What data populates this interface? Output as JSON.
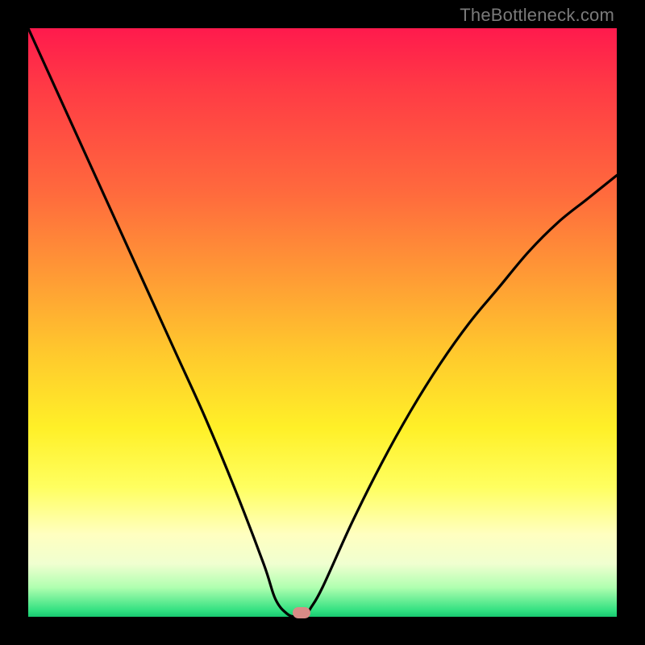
{
  "watermark": "TheBottleneck.com",
  "chart_data": {
    "type": "line",
    "title": "",
    "xlabel": "",
    "ylabel": "",
    "xlim": [
      0,
      100
    ],
    "ylim": [
      0,
      100
    ],
    "series": [
      {
        "name": "bottleneck-curve",
        "x": [
          0,
          5,
          10,
          15,
          20,
          25,
          30,
          35,
          40,
          42,
          44,
          45.5,
          47,
          48,
          50,
          55,
          60,
          65,
          70,
          75,
          80,
          85,
          90,
          95,
          100
        ],
        "values": [
          100,
          89,
          78,
          67,
          56,
          45,
          34,
          22,
          9,
          3,
          0.5,
          0,
          0,
          1.5,
          5,
          16,
          26,
          35,
          43,
          50,
          56,
          62,
          67,
          71,
          75
        ]
      }
    ],
    "annotations": [
      {
        "name": "optimal-marker",
        "x": 46.5,
        "y": 0.7
      }
    ],
    "background_gradient": {
      "top": "#ff1a4d",
      "mid": "#fff028",
      "bottom": "#18c870"
    }
  }
}
